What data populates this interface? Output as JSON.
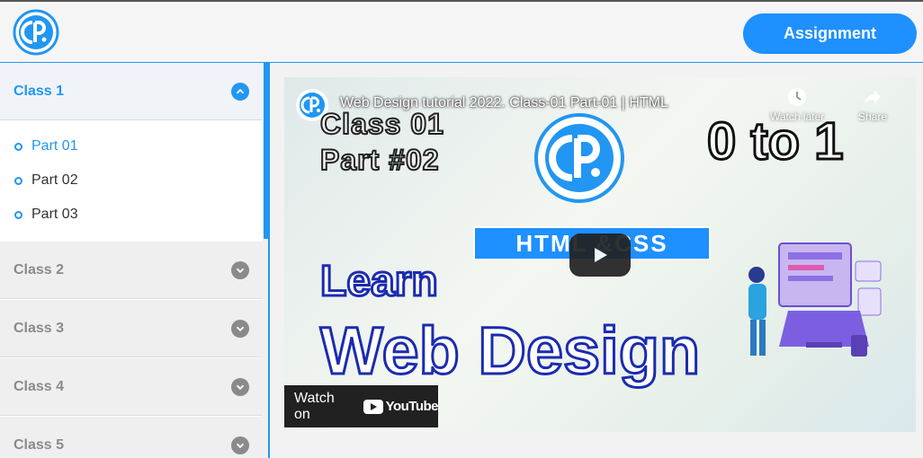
{
  "header": {
    "logo_icon": "cp-logo-icon",
    "assignment_label": "Assignment"
  },
  "sidebar": {
    "classes": [
      {
        "label": "Class 1",
        "expanded": true,
        "parts": [
          "Part 01",
          "Part 02",
          "Part 03"
        ],
        "active_part": "Part 01"
      },
      {
        "label": "Class 2",
        "expanded": false
      },
      {
        "label": "Class 3",
        "expanded": false
      },
      {
        "label": "Class 4",
        "expanded": false
      },
      {
        "label": "Class 5",
        "expanded": false
      }
    ]
  },
  "video": {
    "title": "Web Design tutorial 2022. Class-01 Part-01 | HTML",
    "watch_later_label": "Watch later",
    "share_label": "Share",
    "thumb_class_text": "Class 01",
    "thumb_part_text": "Part #02",
    "thumb_zero_to_one": "0 to 1",
    "thumb_banner": "HTML &CSS",
    "thumb_learn": "Learn",
    "thumb_web_design": "Web Design",
    "watch_on_label": "Watch on",
    "youtube_label": "YouTube"
  },
  "colors": {
    "accent": "#2196f3",
    "button": "#1e90ff",
    "muted": "#8a8a8a"
  }
}
